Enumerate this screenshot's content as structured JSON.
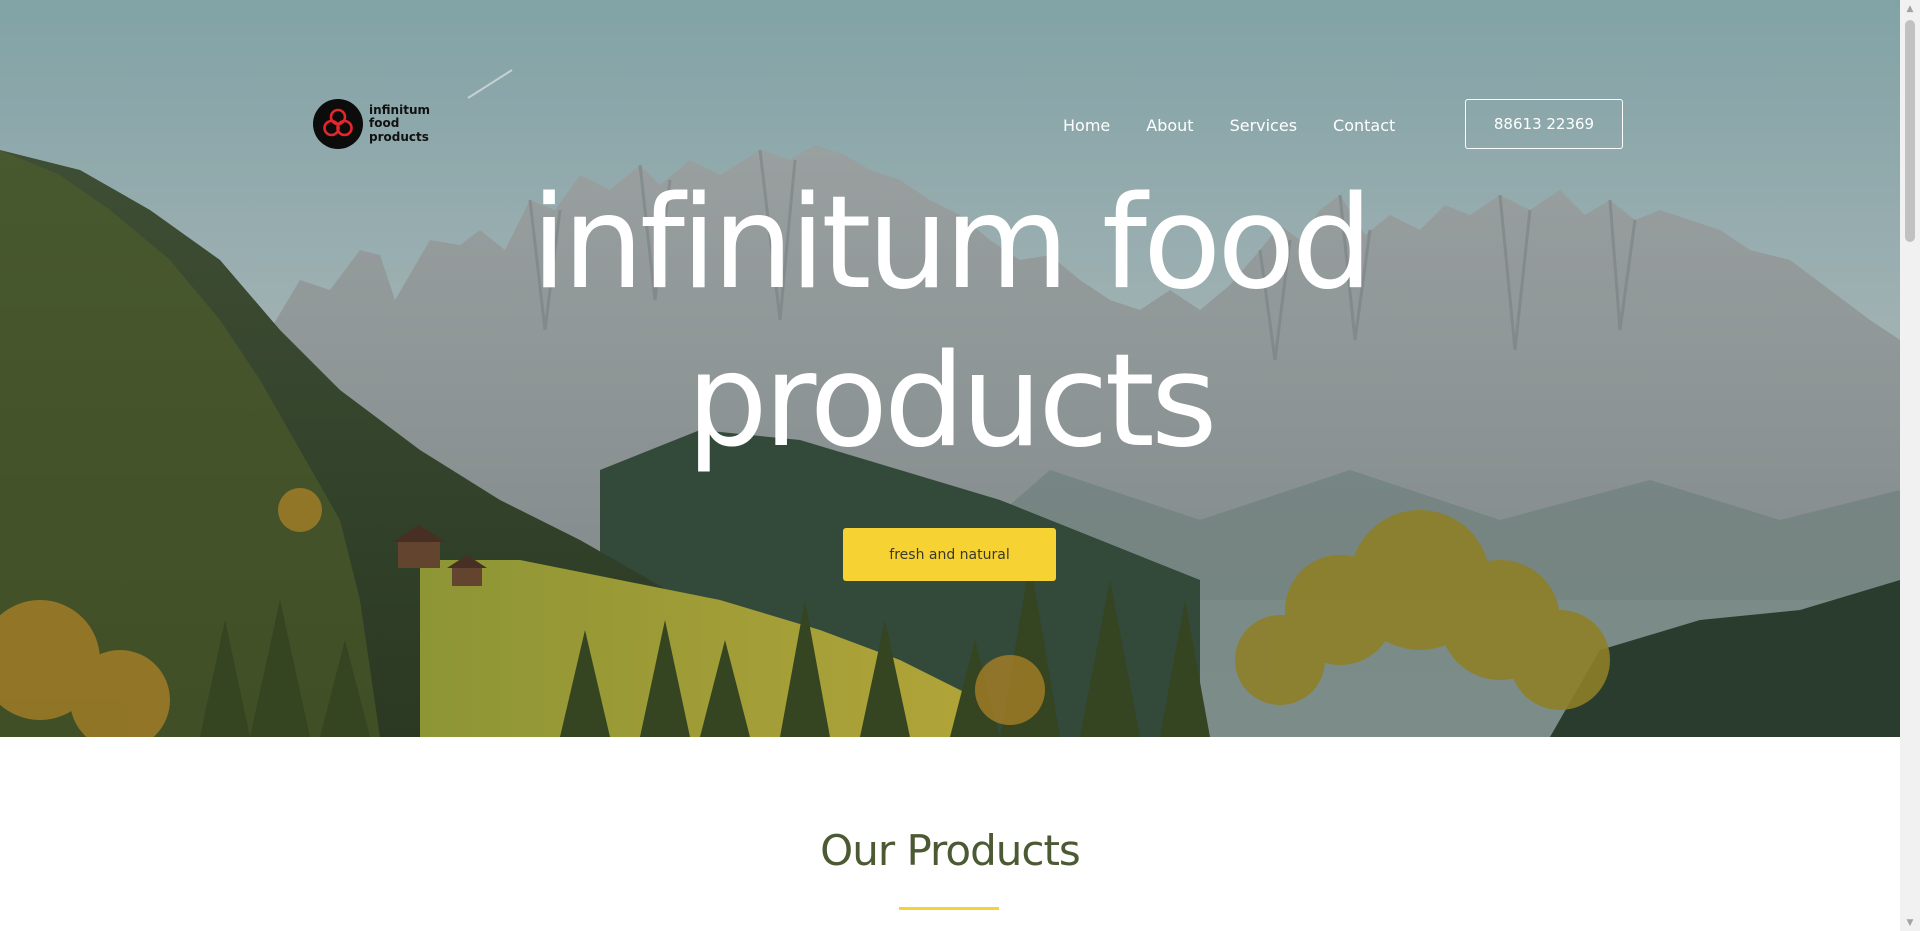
{
  "brand": {
    "logo_icon": "three-circles-logo-icon",
    "name_lines": [
      "infinitum",
      "food",
      "products"
    ]
  },
  "nav": {
    "items": [
      {
        "label": "Home"
      },
      {
        "label": "About"
      },
      {
        "label": "Services"
      },
      {
        "label": "Contact"
      }
    ],
    "phone": "88613 22369"
  },
  "hero": {
    "title_lines": [
      "infinitum food",
      "products"
    ],
    "cta_label": "fresh and natural"
  },
  "products": {
    "heading": "Our Products"
  },
  "colors": {
    "accent": "#f6d232",
    "heading": "#4b5a33",
    "logo_red": "#e5262b"
  },
  "scrollbar": {
    "up_icon": "scroll-up-arrow-icon",
    "down_icon": "scroll-down-arrow-icon"
  }
}
